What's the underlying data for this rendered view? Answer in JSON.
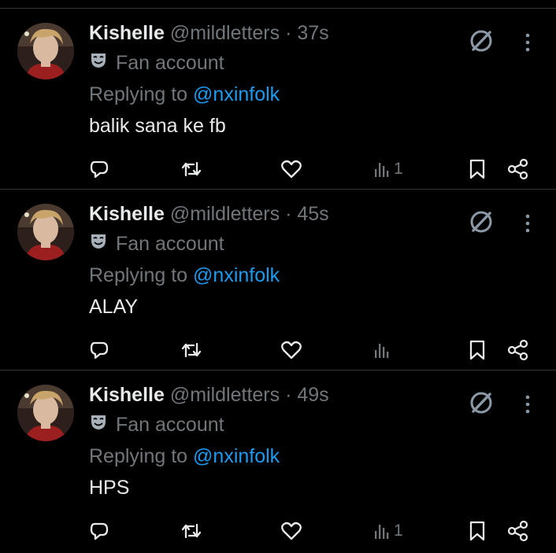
{
  "tweets": [
    {
      "name": "Kishelle",
      "handle": "@mildletters",
      "separator": "·",
      "time": "37s",
      "badge": "Fan account",
      "replying_prefix": "Replying to ",
      "replying_to": "@nxinfolk",
      "text": "balik sana ke fb",
      "views": "1"
    },
    {
      "name": "Kishelle",
      "handle": "@mildletters",
      "separator": "·",
      "time": "45s",
      "badge": "Fan account",
      "replying_prefix": "Replying to ",
      "replying_to": "@nxinfolk",
      "text": "ALAY",
      "views": ""
    },
    {
      "name": "Kishelle",
      "handle": "@mildletters",
      "separator": "·",
      "time": "49s",
      "badge": "Fan account",
      "replying_prefix": "Replying to ",
      "replying_to": "@nxinfolk",
      "text": "HPS",
      "views": "1"
    }
  ],
  "icons": {
    "badge": "theater-mask-icon",
    "mute": "mute-icon",
    "more": "more-vertical-icon",
    "reply": "reply-icon",
    "retweet": "retweet-icon",
    "like": "heart-icon",
    "views": "views-icon",
    "bookmark": "bookmark-icon",
    "share": "share-icon"
  },
  "colors": {
    "background": "#000000",
    "text": "#e7e9ea",
    "muted": "#71767b",
    "mention": "#1d9bf0",
    "divider": "#2f3336"
  }
}
